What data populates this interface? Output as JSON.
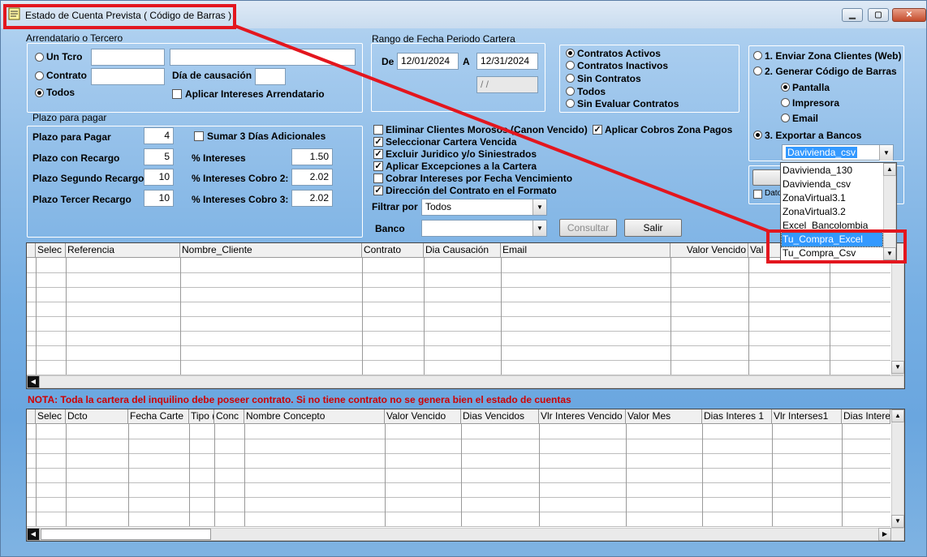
{
  "window": {
    "title": "Estado de Cuenta Prevista ( Código de Barras )"
  },
  "arrendatario": {
    "group_label": "Arrendatario o Tercero",
    "radio_un_tcro": "Un Tcro",
    "radio_contrato": "Contrato",
    "radio_todos": "Todos",
    "dia_causacion_label": "Día de causación",
    "aplicar_intereses_label": "Aplicar Intereses Arrendatario"
  },
  "rango": {
    "group_label": "Rango de Fecha Periodo Cartera",
    "de_label": "De",
    "de_value": "12/01/2024",
    "a_label": "A",
    "a_value": "12/31/2024",
    "blank_date": " / /"
  },
  "contratos": {
    "opt1": "Contratos Activos",
    "opt2": "Contratos Inactivos",
    "opt3": "Sin Contratos",
    "opt4": "Todos",
    "opt5": "Sin Evaluar Contratos"
  },
  "acciones": {
    "opt1": "1. Enviar Zona Clientes (Web)",
    "opt2": "2. Generar Código de Barras",
    "sub1": "Pantalla",
    "sub2": "Impresora",
    "sub3": "Email",
    "opt3": "3. Exportar a Bancos",
    "banco_selected": "Davivienda_csv",
    "partial_label": "Dato"
  },
  "dropdown": {
    "items": [
      "Davivienda_130",
      "Davivienda_csv",
      "ZonaVirtual3.1",
      "ZonaVirtual3.2",
      "Excel_Bancolombia",
      "Tu_Compra_Excel",
      "Tu_Compra_Csv"
    ],
    "selected_index": 5
  },
  "plazo": {
    "group_label": "Plazo para pagar",
    "plazo_pagar_label": "Plazo para Pagar",
    "plazo_pagar_value": "4",
    "sumar_label": "Sumar 3 Días Adicionales",
    "recargo_label": "Plazo con Recargo",
    "recargo_value": "5",
    "intereses_label": "% Intereses",
    "intereses_value": "1.50",
    "segundo_label": "Plazo Segundo Recargo",
    "segundo_value": "10",
    "cobro2_label": "% Intereses Cobro 2:",
    "cobro2_value": "2.02",
    "tercer_label": "Plazo Tercer Recargo",
    "tercer_value": "10",
    "cobro3_label": "% Intereses Cobro 3:",
    "cobro3_value": "2.02"
  },
  "opciones": {
    "eliminar": "Eliminar Clientes Morosos (Canon Vencido)",
    "aplicar_cobros": "Aplicar Cobros Zona Pagos",
    "seleccionar": "Seleccionar Cartera Vencida",
    "excluir": "Excluir Juridico y/o Siniestrados",
    "excepciones": "Aplicar Excepciones a la Cartera",
    "cobrar": "Cobrar Intereses por Fecha Vencimiento",
    "direccion": "Dirección del Contrato en el Formato",
    "filtrar_label": "Filtrar por",
    "filtrar_value": "Todos",
    "banco_label": "Banco",
    "banco_value": "",
    "consultar": "Consultar",
    "salir": "Salir"
  },
  "grid1": {
    "columns": [
      "Selec",
      "Referencia",
      "Nombre_Cliente",
      "Contrato",
      "Dia Causación",
      "Email",
      "Valor Vencido",
      "Val"
    ]
  },
  "note": "NOTA: Toda la cartera del inquilino debe poseer contrato. Si no tiene contrato no se genera bien el estado de cuentas",
  "grid2": {
    "columns": [
      "Selec",
      "Dcto",
      "Fecha Carte",
      "Tipo (",
      "Conc",
      "Nombre Concepto",
      "Valor Vencido",
      "Dias Vencidos",
      "Vlr Interes Vencido",
      "Valor Mes",
      "Dias Interes 1",
      "Vlr Interses1",
      "Dias Intere"
    ]
  },
  "colors": {
    "highlight": "#e3161e",
    "note": "#d00000",
    "selection": "#3399ff"
  }
}
